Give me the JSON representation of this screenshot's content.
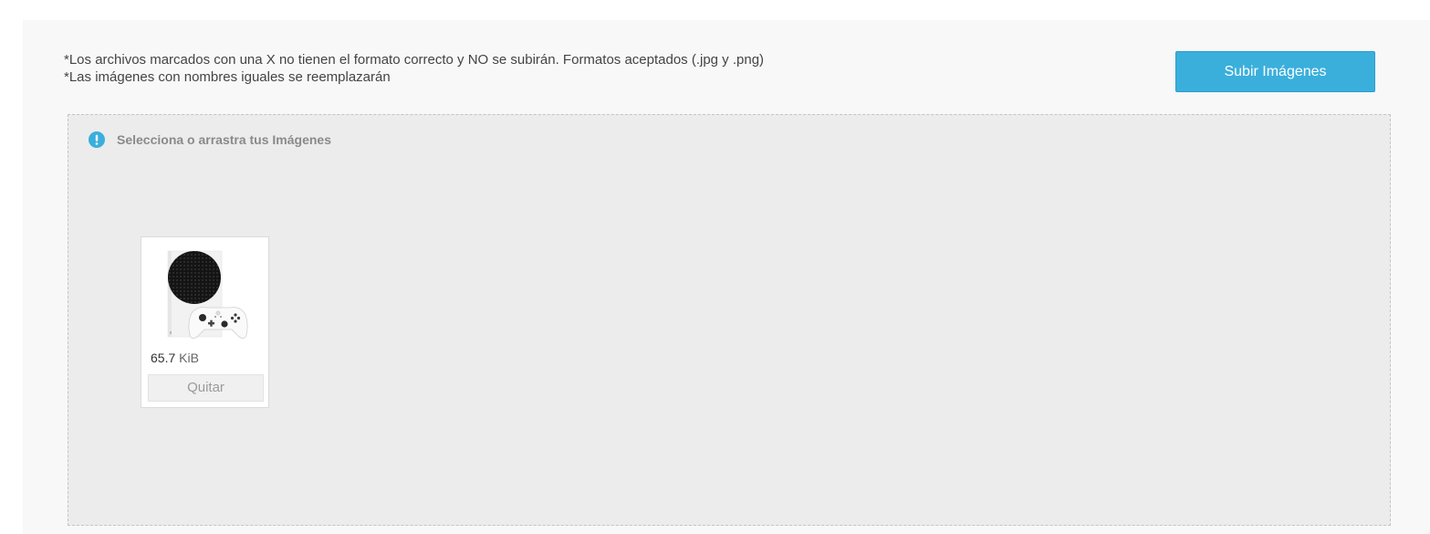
{
  "notes": {
    "line1": "*Los archivos marcados con una X no tienen el formato correcto y NO se subirán. Formatos aceptados (.jpg y .png)",
    "line2": "*Las imágenes con nombres iguales se reemplazarán"
  },
  "toolbar": {
    "upload_label": "Subir Imágenes"
  },
  "dropzone": {
    "hint": "Selecciona o arrastra tus Imágenes",
    "hint_icon": "info-icon"
  },
  "files": [
    {
      "thumbnail": "xbox-console-controller-image",
      "size_value": "65.7",
      "size_unit": "KiB",
      "remove_label": "Quitar"
    }
  ],
  "colors": {
    "accent": "#3aafdc",
    "dropzone_bg": "#ececec",
    "panel_bg": "#f8f8f8"
  }
}
